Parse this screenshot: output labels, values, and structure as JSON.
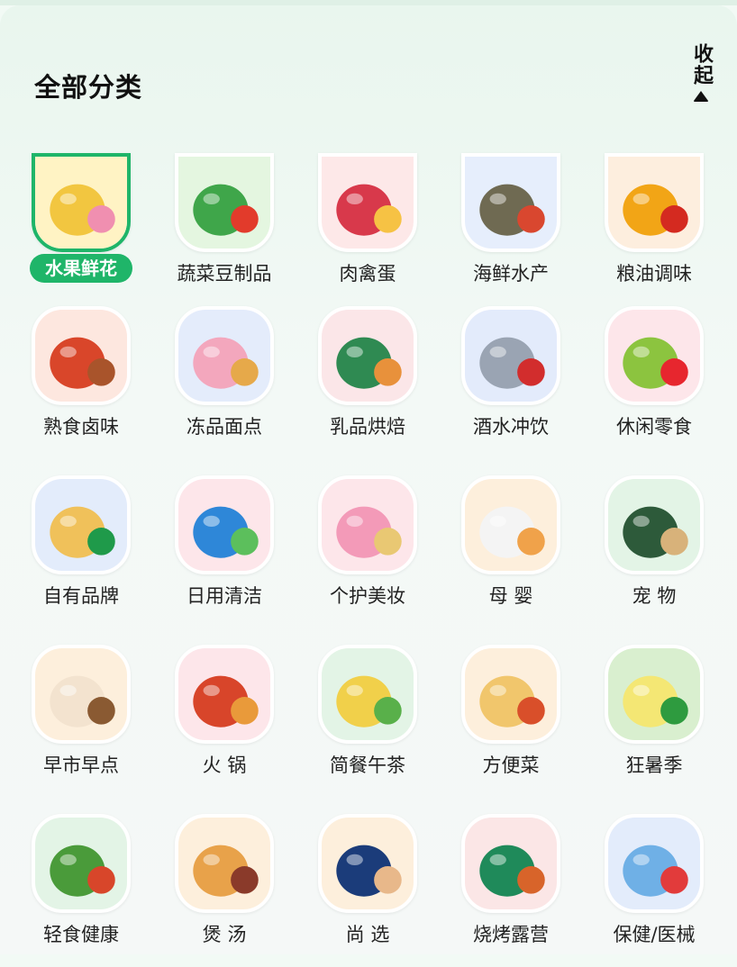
{
  "header": {
    "title": "全部分类",
    "collapse_label": "收起"
  },
  "categories": [
    {
      "label": "水果鲜花",
      "icon": "fruit-flower-icon",
      "selected": true,
      "bg": "#fff3c4",
      "fg": "#f2c640",
      "accent": "#f08fb0"
    },
    {
      "label": "蔬菜豆制品",
      "icon": "vegetable-icon",
      "selected": false,
      "bg": "#e4f6e0",
      "fg": "#3fa64a",
      "accent": "#e23b2b"
    },
    {
      "label": "肉禽蛋",
      "icon": "meat-egg-icon",
      "selected": false,
      "bg": "#fde8e8",
      "fg": "#d8394b",
      "accent": "#f6c244"
    },
    {
      "label": "海鲜水产",
      "icon": "seafood-icon",
      "selected": false,
      "bg": "#e6eefc",
      "fg": "#6f6a52",
      "accent": "#d9472f"
    },
    {
      "label": "粮油调味",
      "icon": "grain-oil-icon",
      "selected": false,
      "bg": "#fdeede",
      "fg": "#f2a516",
      "accent": "#d42a20"
    },
    {
      "label": "熟食卤味",
      "icon": "deli-icon",
      "selected": false,
      "bg": "#fde7df",
      "fg": "#d9462a",
      "accent": "#a9542b"
    },
    {
      "label": "冻品面点",
      "icon": "frozen-icon",
      "selected": false,
      "bg": "#e4ecfb",
      "fg": "#f3a7bd",
      "accent": "#e6a94a"
    },
    {
      "label": "乳品烘焙",
      "icon": "dairy-bakery-icon",
      "selected": false,
      "bg": "#fbe6e8",
      "fg": "#2f8a52",
      "accent": "#e8913b"
    },
    {
      "label": "酒水冲饮",
      "icon": "drink-icon",
      "selected": false,
      "bg": "#e3ebfb",
      "fg": "#9aa4b3",
      "accent": "#d22d2d"
    },
    {
      "label": "休闲零食",
      "icon": "snack-icon",
      "selected": false,
      "bg": "#fde6ea",
      "fg": "#8cc43f",
      "accent": "#e7262e"
    },
    {
      "label": "自有品牌",
      "icon": "own-brand-icon",
      "selected": false,
      "bg": "#e3ecfb",
      "fg": "#f0c15a",
      "accent": "#1f9a4a"
    },
    {
      "label": "日用清洁",
      "icon": "cleaning-icon",
      "selected": false,
      "bg": "#fde6ea",
      "fg": "#2e87d8",
      "accent": "#5cbf5c"
    },
    {
      "label": "个护美妆",
      "icon": "beauty-icon",
      "selected": false,
      "bg": "#fde6ea",
      "fg": "#f39ab8",
      "accent": "#e9c873"
    },
    {
      "label": "母 婴",
      "icon": "baby-icon",
      "selected": false,
      "bg": "#fdefdc",
      "fg": "#f4f4f4",
      "accent": "#f0a24a"
    },
    {
      "label": "宠 物",
      "icon": "pet-icon",
      "selected": false,
      "bg": "#e3f4e6",
      "fg": "#2d5a3a",
      "accent": "#d8b27a"
    },
    {
      "label": "早市早点",
      "icon": "breakfast-icon",
      "selected": false,
      "bg": "#fdefdc",
      "fg": "#f3e3cf",
      "accent": "#8a5a32"
    },
    {
      "label": "火 锅",
      "icon": "hotpot-icon",
      "selected": false,
      "bg": "#fde6ea",
      "fg": "#d8452a",
      "accent": "#e99a3a"
    },
    {
      "label": "简餐午茶",
      "icon": "afternoon-tea-icon",
      "selected": false,
      "bg": "#e3f4e6",
      "fg": "#f1d04a",
      "accent": "#59b04a"
    },
    {
      "label": "方便菜",
      "icon": "ready-meal-icon",
      "selected": false,
      "bg": "#fdefdc",
      "fg": "#f1c66c",
      "accent": "#d94f2a"
    },
    {
      "label": "狂暑季",
      "icon": "summer-icon",
      "selected": false,
      "bg": "#d9efcf",
      "fg": "#f4e774",
      "accent": "#2e9b3f"
    },
    {
      "label": "轻食健康",
      "icon": "healthy-food-icon",
      "selected": false,
      "bg": "#e3f4e6",
      "fg": "#4a9b3a",
      "accent": "#d8462a"
    },
    {
      "label": "煲 汤",
      "icon": "soup-icon",
      "selected": false,
      "bg": "#fdefdc",
      "fg": "#e8a24a",
      "accent": "#8a3a2a"
    },
    {
      "label": "尚 选",
      "icon": "shopping-bag-icon",
      "selected": false,
      "bg": "#fdefdc",
      "fg": "#1b3c7a",
      "accent": "#e8b88a"
    },
    {
      "label": "烧烤露营",
      "icon": "bbq-camping-icon",
      "selected": false,
      "bg": "#fbe6e6",
      "fg": "#1f8a5a",
      "accent": "#d8642a"
    },
    {
      "label": "保健/医械",
      "icon": "health-care-icon",
      "selected": false,
      "bg": "#e3ecfb",
      "fg": "#6fb0e6",
      "accent": "#e23b3b"
    }
  ]
}
